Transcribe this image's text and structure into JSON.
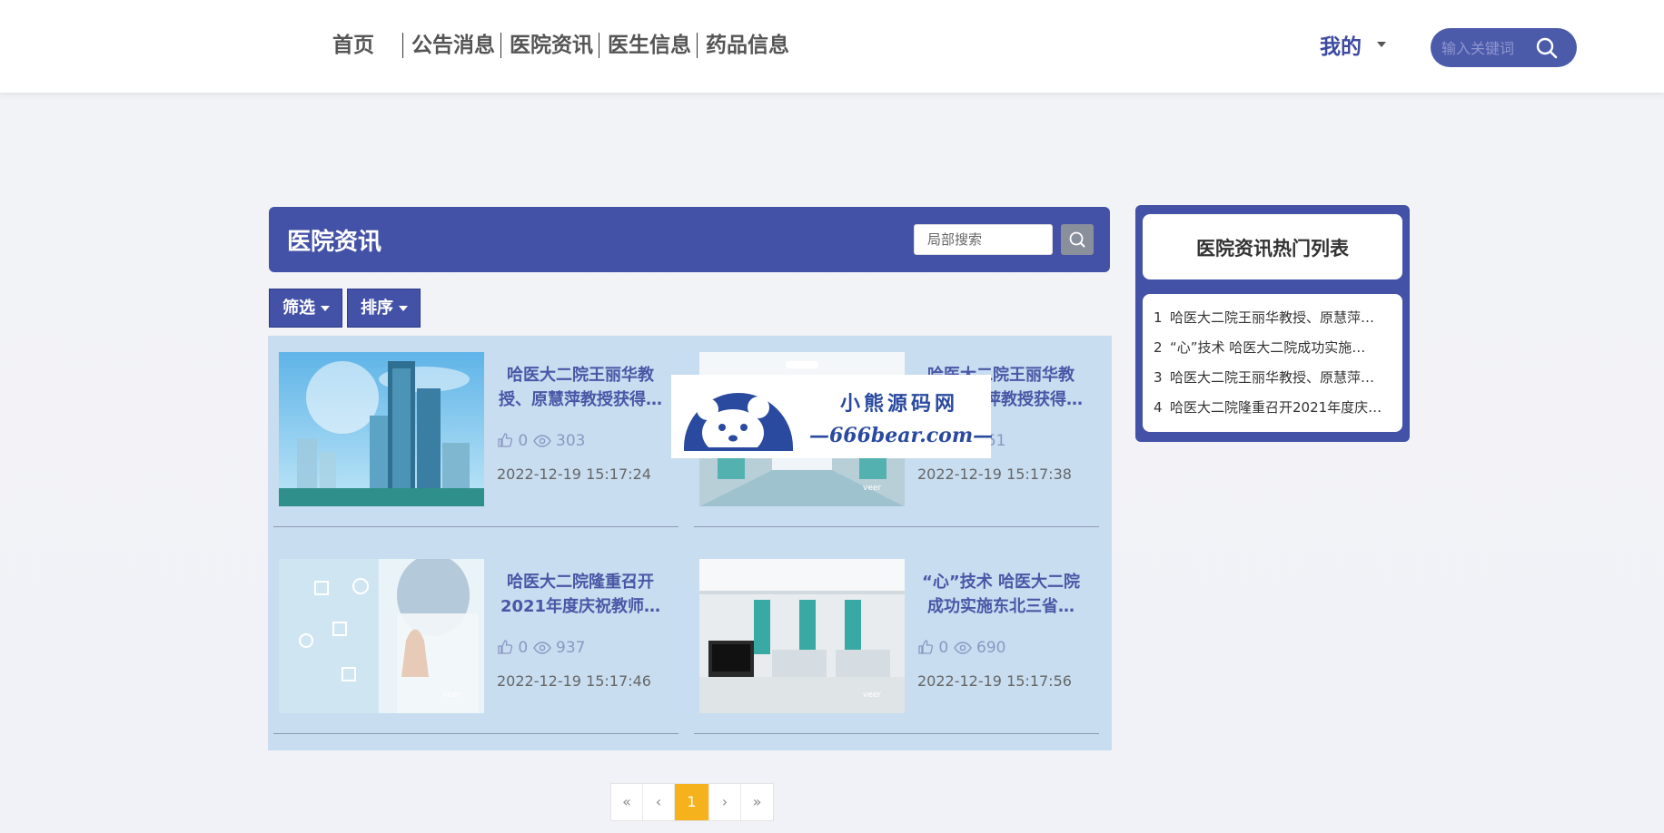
{
  "nav": {
    "items": [
      "首页",
      "公告消息",
      "医院资讯",
      "医生信息",
      "药品信息"
    ],
    "mine": "我的",
    "search_placeholder": "输入关键词"
  },
  "main": {
    "title": "医院资讯",
    "local_search_placeholder": "局部搜索",
    "filter_label": "筛选",
    "sort_label": "排序"
  },
  "cards": [
    {
      "title": "哈医大二院王丽华教授、原慧萍教授获得…",
      "likes": "0",
      "views": "303",
      "time": "2022-12-19 15:17:24",
      "image": "hospital-building"
    },
    {
      "title": "哈医大二院王丽华教授、原慧萍教授获得…",
      "likes": "0",
      "views": "451",
      "time": "2022-12-19 15:17:38",
      "image": "hospital-corridor"
    },
    {
      "title": "哈医大二院隆重召开2021年度庆祝教师…",
      "likes": "0",
      "views": "937",
      "time": "2022-12-19 15:17:46",
      "image": "doctor-touchscreen"
    },
    {
      "title": "“心”技术 哈医大二院成功实施东北三省…",
      "likes": "0",
      "views": "690",
      "time": "2022-12-19 15:17:56",
      "image": "hospital-ward"
    }
  ],
  "watermark": {
    "line1": "小熊源码网",
    "line2": "—666bear.com—"
  },
  "pagination": {
    "first": "«",
    "prev": "‹",
    "current": "1",
    "next": "›",
    "last": "»"
  },
  "hot": {
    "title": "医院资讯热门列表",
    "items": [
      {
        "num": "1",
        "text": "哈医大二院王丽华教授、原慧萍…"
      },
      {
        "num": "2",
        "text": "“心”技术 哈医大二院成功实施…"
      },
      {
        "num": "3",
        "text": "哈医大二院王丽华教授、原慧萍…"
      },
      {
        "num": "4",
        "text": "哈医大二院隆重召开2021年度庆…"
      }
    ]
  },
  "colors": {
    "primary": "#4352a6",
    "panel": "#c8ddf0",
    "page_active": "#f6b21d"
  }
}
